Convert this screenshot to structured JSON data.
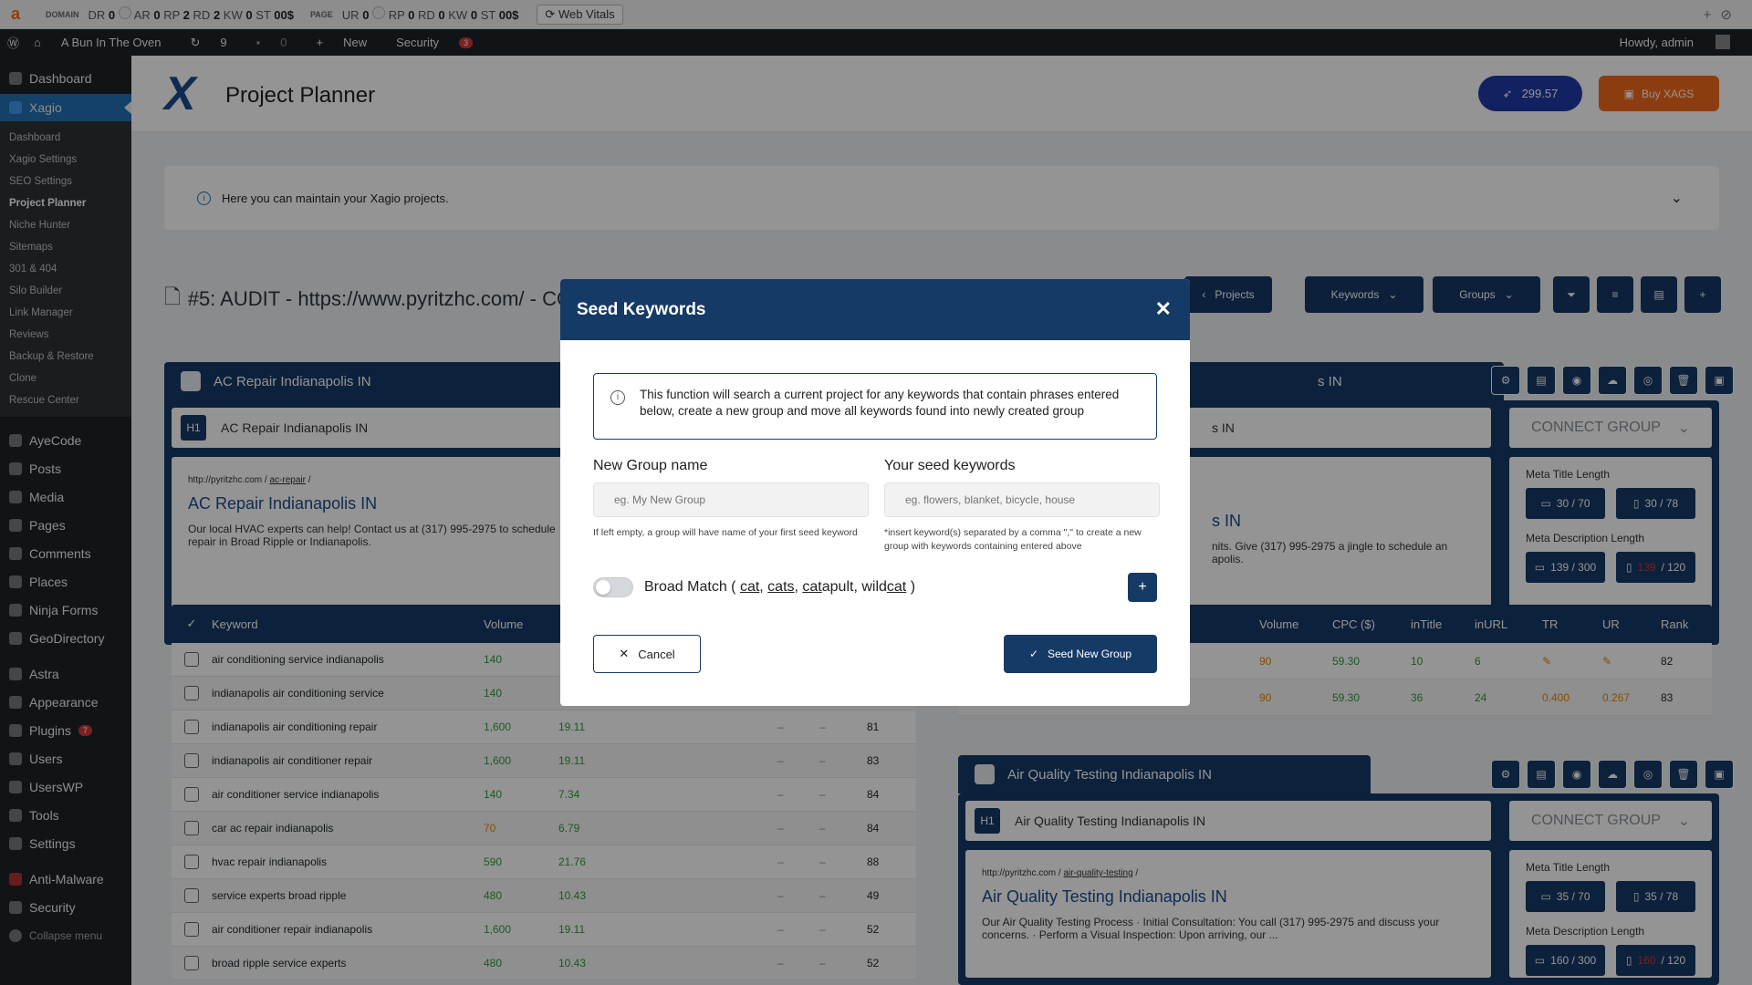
{
  "ext_bar": {
    "domain_label": "DOMAIN",
    "domain_metrics": [
      "DR",
      "0",
      "AR",
      "0",
      "RP",
      "2",
      "RD",
      "2",
      "KW",
      "0",
      "ST",
      "0",
      "0$"
    ],
    "page_label": "PAGE",
    "page_metrics": [
      "UR",
      "0",
      "RP",
      "0",
      "RD",
      "0",
      "KW",
      "0",
      "ST",
      "0",
      "0$"
    ],
    "web_vitals": "Web Vitals"
  },
  "admin_bar": {
    "site_name": "A Bun In The Oven",
    "updates": "9",
    "comments": "0",
    "new": "New",
    "security": "Security",
    "security_count": "3",
    "howdy": "Howdy, admin"
  },
  "sidebar": {
    "dashboard": "Dashboard",
    "xagio": "Xagio",
    "xagio_sub": [
      "Dashboard",
      "Xagio Settings",
      "SEO Settings",
      "Project Planner",
      "Niche Hunter",
      "Sitemaps",
      "301 & 404",
      "Silo Builder",
      "Link Manager",
      "Reviews",
      "Backup & Restore",
      "Clone",
      "Rescue Center"
    ],
    "menu": [
      "AyeCode",
      "Posts",
      "Media",
      "Pages",
      "Comments",
      "Places",
      "Ninja Forms",
      "GeoDirectory",
      "Astra",
      "Appearance",
      "Plugins",
      "Users",
      "UsersWP",
      "Tools",
      "Settings",
      "Anti-Malware",
      "Security",
      "Collapse menu"
    ],
    "plugins_count": "7"
  },
  "header": {
    "title": "Project Planner",
    "credits": "299.57",
    "buy": "Buy XAGS"
  },
  "notice": "Here you can maintain your Xagio projects.",
  "project_title": "#5: AUDIT - https://www.pyritzhc.com/ - CO",
  "toolbar": {
    "projects": "Projects",
    "keywords": "Keywords",
    "groups": "Groups"
  },
  "group1": {
    "name": "AC Repair Indianapolis IN",
    "h1": "AC Repair Indianapolis IN",
    "h1_tag": "H1",
    "url_base": "http://pyritzhc.com",
    "url_slug": "ac-repair",
    "serp_title": "AC Repair Indianapolis IN",
    "serp_desc": "Our local HVAC experts can help! Contact us at (317) 995-2975 to schedule repair in Broad Ripple or Indianapolis."
  },
  "group2": {
    "name_partial": "s IN",
    "serp_title_partial": "s IN",
    "serp_desc_partial": "nits. Give (317) 995-2975 a jingle to schedule an",
    "serp_desc_partial2": "apolis.",
    "connect": "CONNECT GROUP",
    "meta_title_label": "Meta Title Length",
    "meta_title_desktop": "30 / 70",
    "meta_title_mobile": "30 / 78",
    "meta_desc_label": "Meta Description Length",
    "meta_desc_desktop": "139 / 300",
    "meta_desc_mobile_over": "139",
    "meta_desc_mobile_max": "/ 120"
  },
  "group3": {
    "name": "Air Quality Testing Indianapolis IN",
    "h1": "Air Quality Testing Indianapolis IN",
    "h1_tag": "H1",
    "url_base": "http://pyritzhc.com",
    "url_slug": "air-quality-testing",
    "serp_title": "Air Quality Testing Indianapolis IN",
    "serp_desc": "Our Air Quality Testing Process · Initial Consultation: You call (317) 995-2975 and discuss your concerns. · Perform a Visual Inspection: Upon arriving, our ...",
    "connect": "CONNECT GROUP",
    "meta_title_label": "Meta Title Length",
    "meta_title_desktop": "35 / 70",
    "meta_title_mobile": "35 / 78",
    "meta_desc_label": "Meta Description Length",
    "meta_desc_desktop": "160 / 300",
    "meta_desc_mobile_over": "160",
    "meta_desc_mobile_max": "/ 120"
  },
  "table1": {
    "headers": [
      "Keyword",
      "Volume"
    ],
    "rows": [
      {
        "kw": "air conditioning service indianapolis",
        "vol": "140",
        "cpc": "",
        "a": "",
        "b": "",
        "rank": ""
      },
      {
        "kw": "indianapolis air conditioning service",
        "vol": "140",
        "cpc": "",
        "a": "",
        "b": "",
        "rank": ""
      },
      {
        "kw": "indianapolis air conditioning repair",
        "vol": "1,600",
        "cpc": "19.11",
        "a": "–",
        "b": "–",
        "rank": "81"
      },
      {
        "kw": "indianapolis air conditioner repair",
        "vol": "1,600",
        "cpc": "19.11",
        "a": "–",
        "b": "–",
        "rank": "83"
      },
      {
        "kw": "air conditioner service indianapolis",
        "vol": "140",
        "cpc": "7.34",
        "a": "–",
        "b": "–",
        "rank": "84"
      },
      {
        "kw": "car ac repair indianapolis",
        "vol": "70",
        "cpc": "6.79",
        "a": "–",
        "b": "–",
        "rank": "84"
      },
      {
        "kw": "hvac repair indianapolis",
        "vol": "590",
        "cpc": "21.76",
        "a": "–",
        "b": "–",
        "rank": "88"
      },
      {
        "kw": "service experts broad ripple",
        "vol": "480",
        "cpc": "10.43",
        "a": "–",
        "b": "–",
        "rank": "49"
      },
      {
        "kw": "air conditioner repair indianapolis",
        "vol": "1,600",
        "cpc": "19.11",
        "a": "–",
        "b": "–",
        "rank": "52"
      },
      {
        "kw": "broad ripple service experts",
        "vol": "480",
        "cpc": "10.43",
        "a": "–",
        "b": "–",
        "rank": "52"
      }
    ]
  },
  "table2": {
    "headers": [
      "Volume",
      "CPC ($)",
      "inTitle",
      "inURL",
      "TR",
      "UR",
      "Rank"
    ],
    "rows": [
      {
        "vol": "90",
        "cpc": "59.30",
        "intitle": "10",
        "inurl": "6",
        "tr": "",
        "ur": "",
        "rank": "82"
      },
      {
        "vol": "90",
        "cpc": "59.30",
        "intitle": "36",
        "inurl": "24",
        "tr": "0.400",
        "ur": "0.267",
        "rank": "83"
      }
    ]
  },
  "modal": {
    "title": "Seed Keywords",
    "info": "This function will search a current project for any keywords that contain phrases entered below, create a new group and move all keywords found into newly created group",
    "group_label": "New Group name",
    "group_placeholder": "eg. My New Group",
    "group_hint": "If left empty, a group will have name of your first seed keyword",
    "seed_label": "Your seed keywords",
    "seed_placeholder": "eg. flowers, blanket, bicycle, house",
    "seed_hint": "*insert keyword(s) separated by a comma \",\" to create a new group with keywords containing entered above",
    "broad_prefix": "Broad Match (",
    "broad_words": [
      "cat",
      "cats",
      "cat",
      "apult",
      "wild",
      "cat"
    ],
    "broad_suffix": ")",
    "cancel": "Cancel",
    "submit": "Seed New Group"
  }
}
